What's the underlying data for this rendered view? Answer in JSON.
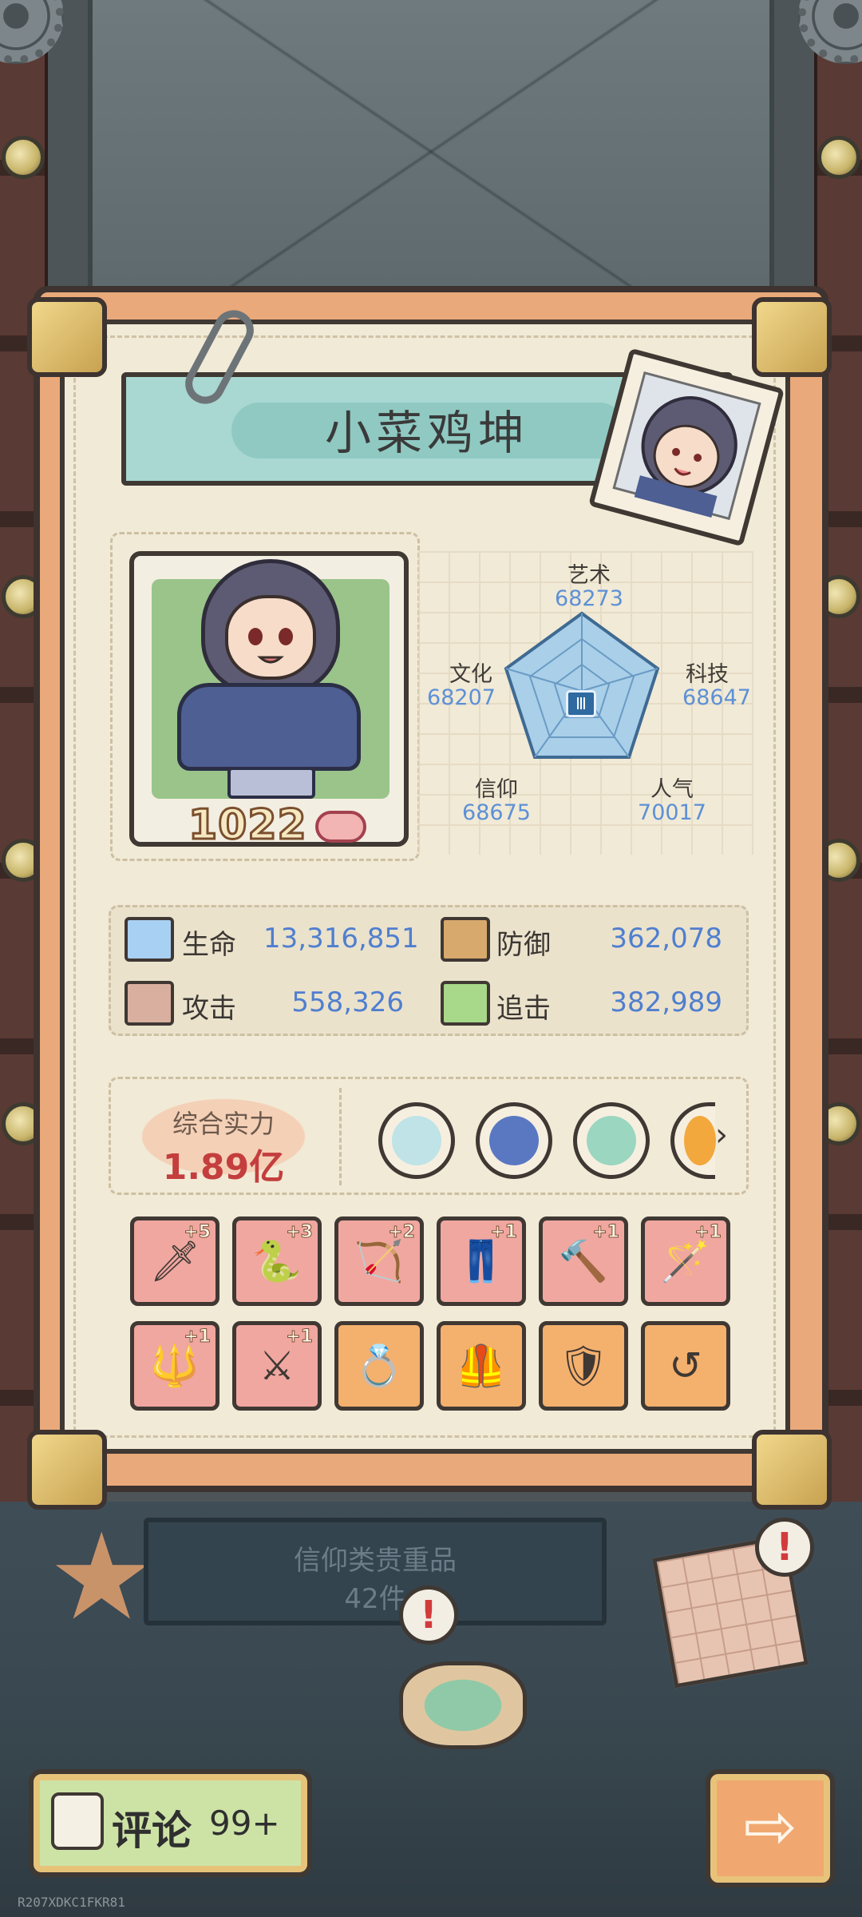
{
  "player": {
    "name": "小菜鸡坤",
    "level": "1022"
  },
  "radar": {
    "stats": [
      {
        "label": "艺术",
        "value": "68273"
      },
      {
        "label": "文化",
        "value": "68207"
      },
      {
        "label": "科技",
        "value": "68647"
      },
      {
        "label": "信仰",
        "value": "68675"
      },
      {
        "label": "人气",
        "value": "70017"
      }
    ],
    "center_glyph": "Ⅲ"
  },
  "attributes": [
    {
      "label": "生命",
      "value": "13,316,851",
      "icon": "health-icon",
      "color": "#a8d0f2"
    },
    {
      "label": "防御",
      "value": "362,078",
      "icon": "defense-icon",
      "color": "#d8a96c"
    },
    {
      "label": "攻击",
      "value": "558,326",
      "icon": "attack-icon",
      "color": "#d9b0a0"
    },
    {
      "label": "追击",
      "value": "382,989",
      "icon": "pursuit-icon",
      "color": "#a8d88a"
    }
  ],
  "power": {
    "title": "综合实力",
    "value": "1.89亿"
  },
  "badges": [
    {
      "icon": "dragon-badge-icon",
      "color": "#bfe3e6"
    },
    {
      "icon": "fang-badge-icon",
      "color": "#5a78c2"
    },
    {
      "icon": "frame-badge-icon",
      "color": "#9ad6c0"
    },
    {
      "icon": "flask-badge-icon",
      "color": "#f2a83c"
    }
  ],
  "equipment": [
    {
      "icon": "dagger-icon",
      "glyph": "🗡",
      "plus": "+5",
      "rarity": "red"
    },
    {
      "icon": "serpent-staff-icon",
      "glyph": "🐍",
      "plus": "+3",
      "rarity": "red"
    },
    {
      "icon": "crossbow-icon",
      "glyph": "🏹",
      "plus": "+2",
      "rarity": "red"
    },
    {
      "icon": "pants-icon",
      "glyph": "👖",
      "plus": "+1",
      "rarity": "red"
    },
    {
      "icon": "hammer-icon",
      "glyph": "🔨",
      "plus": "+1",
      "rarity": "red"
    },
    {
      "icon": "wand-icon",
      "glyph": "🪄",
      "plus": "+1",
      "rarity": "red"
    },
    {
      "icon": "trident-icon",
      "glyph": "🔱",
      "plus": "+1",
      "rarity": "red"
    },
    {
      "icon": "sword-icon",
      "glyph": "⚔",
      "plus": "+1",
      "rarity": "red"
    },
    {
      "icon": "ring-icon",
      "glyph": "💍",
      "plus": "",
      "rarity": "orange"
    },
    {
      "icon": "vest-icon",
      "glyph": "🦺",
      "plus": "",
      "rarity": "orange"
    },
    {
      "icon": "shield-icon",
      "glyph": "🛡",
      "plus": "",
      "rarity": "orange"
    },
    {
      "icon": "hook-icon",
      "glyph": "↺",
      "plus": "",
      "rarity": "orange"
    }
  ],
  "collection": {
    "title": "信仰类贵重品",
    "count": "42件"
  },
  "footer": {
    "comment_label": "评论",
    "comment_count": "99+",
    "next_arrow": "⇨",
    "watermark": "R207XDKC1FKR81"
  },
  "alerts": [
    "!",
    "!"
  ]
}
